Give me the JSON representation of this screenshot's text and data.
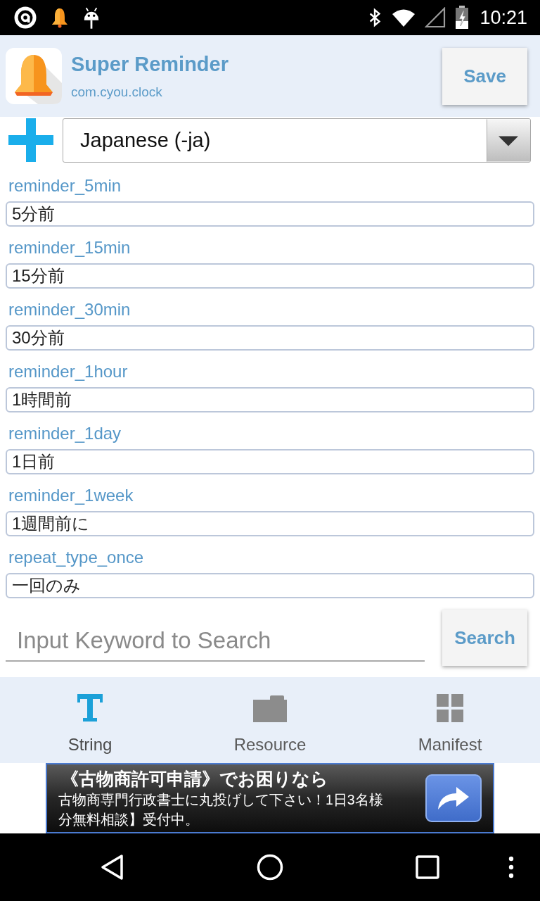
{
  "status_bar": {
    "time": "10:21"
  },
  "header": {
    "app_name": "Super Reminder",
    "package": "com.cyou.clock",
    "save_button": "Save"
  },
  "language": {
    "value": "Japanese (-ja)"
  },
  "strings": [
    {
      "key": "reminder_5min",
      "value": "5分前"
    },
    {
      "key": "reminder_15min",
      "value": "15分前"
    },
    {
      "key": "reminder_30min",
      "value": "30分前"
    },
    {
      "key": "reminder_1hour",
      "value": "1時間前"
    },
    {
      "key": "reminder_1day",
      "value": "1日前"
    },
    {
      "key": "reminder_1week",
      "value": "1週間前に"
    },
    {
      "key": "repeat_type_once",
      "value": "一回のみ"
    }
  ],
  "search": {
    "placeholder": "Input Keyword to Search",
    "button": "Search"
  },
  "tabs": [
    {
      "label": "String",
      "kind": "text",
      "selected": true
    },
    {
      "label": "Resource",
      "kind": "folder",
      "selected": false
    },
    {
      "label": "Manifest",
      "kind": "grid",
      "selected": false
    }
  ],
  "ad": {
    "title": "《古物商許可申請》でお困りなら",
    "lines": [
      "古物商専門行政書士に丸投げして下さい！1日3名様",
      "分無料相談】受付中。"
    ]
  }
}
